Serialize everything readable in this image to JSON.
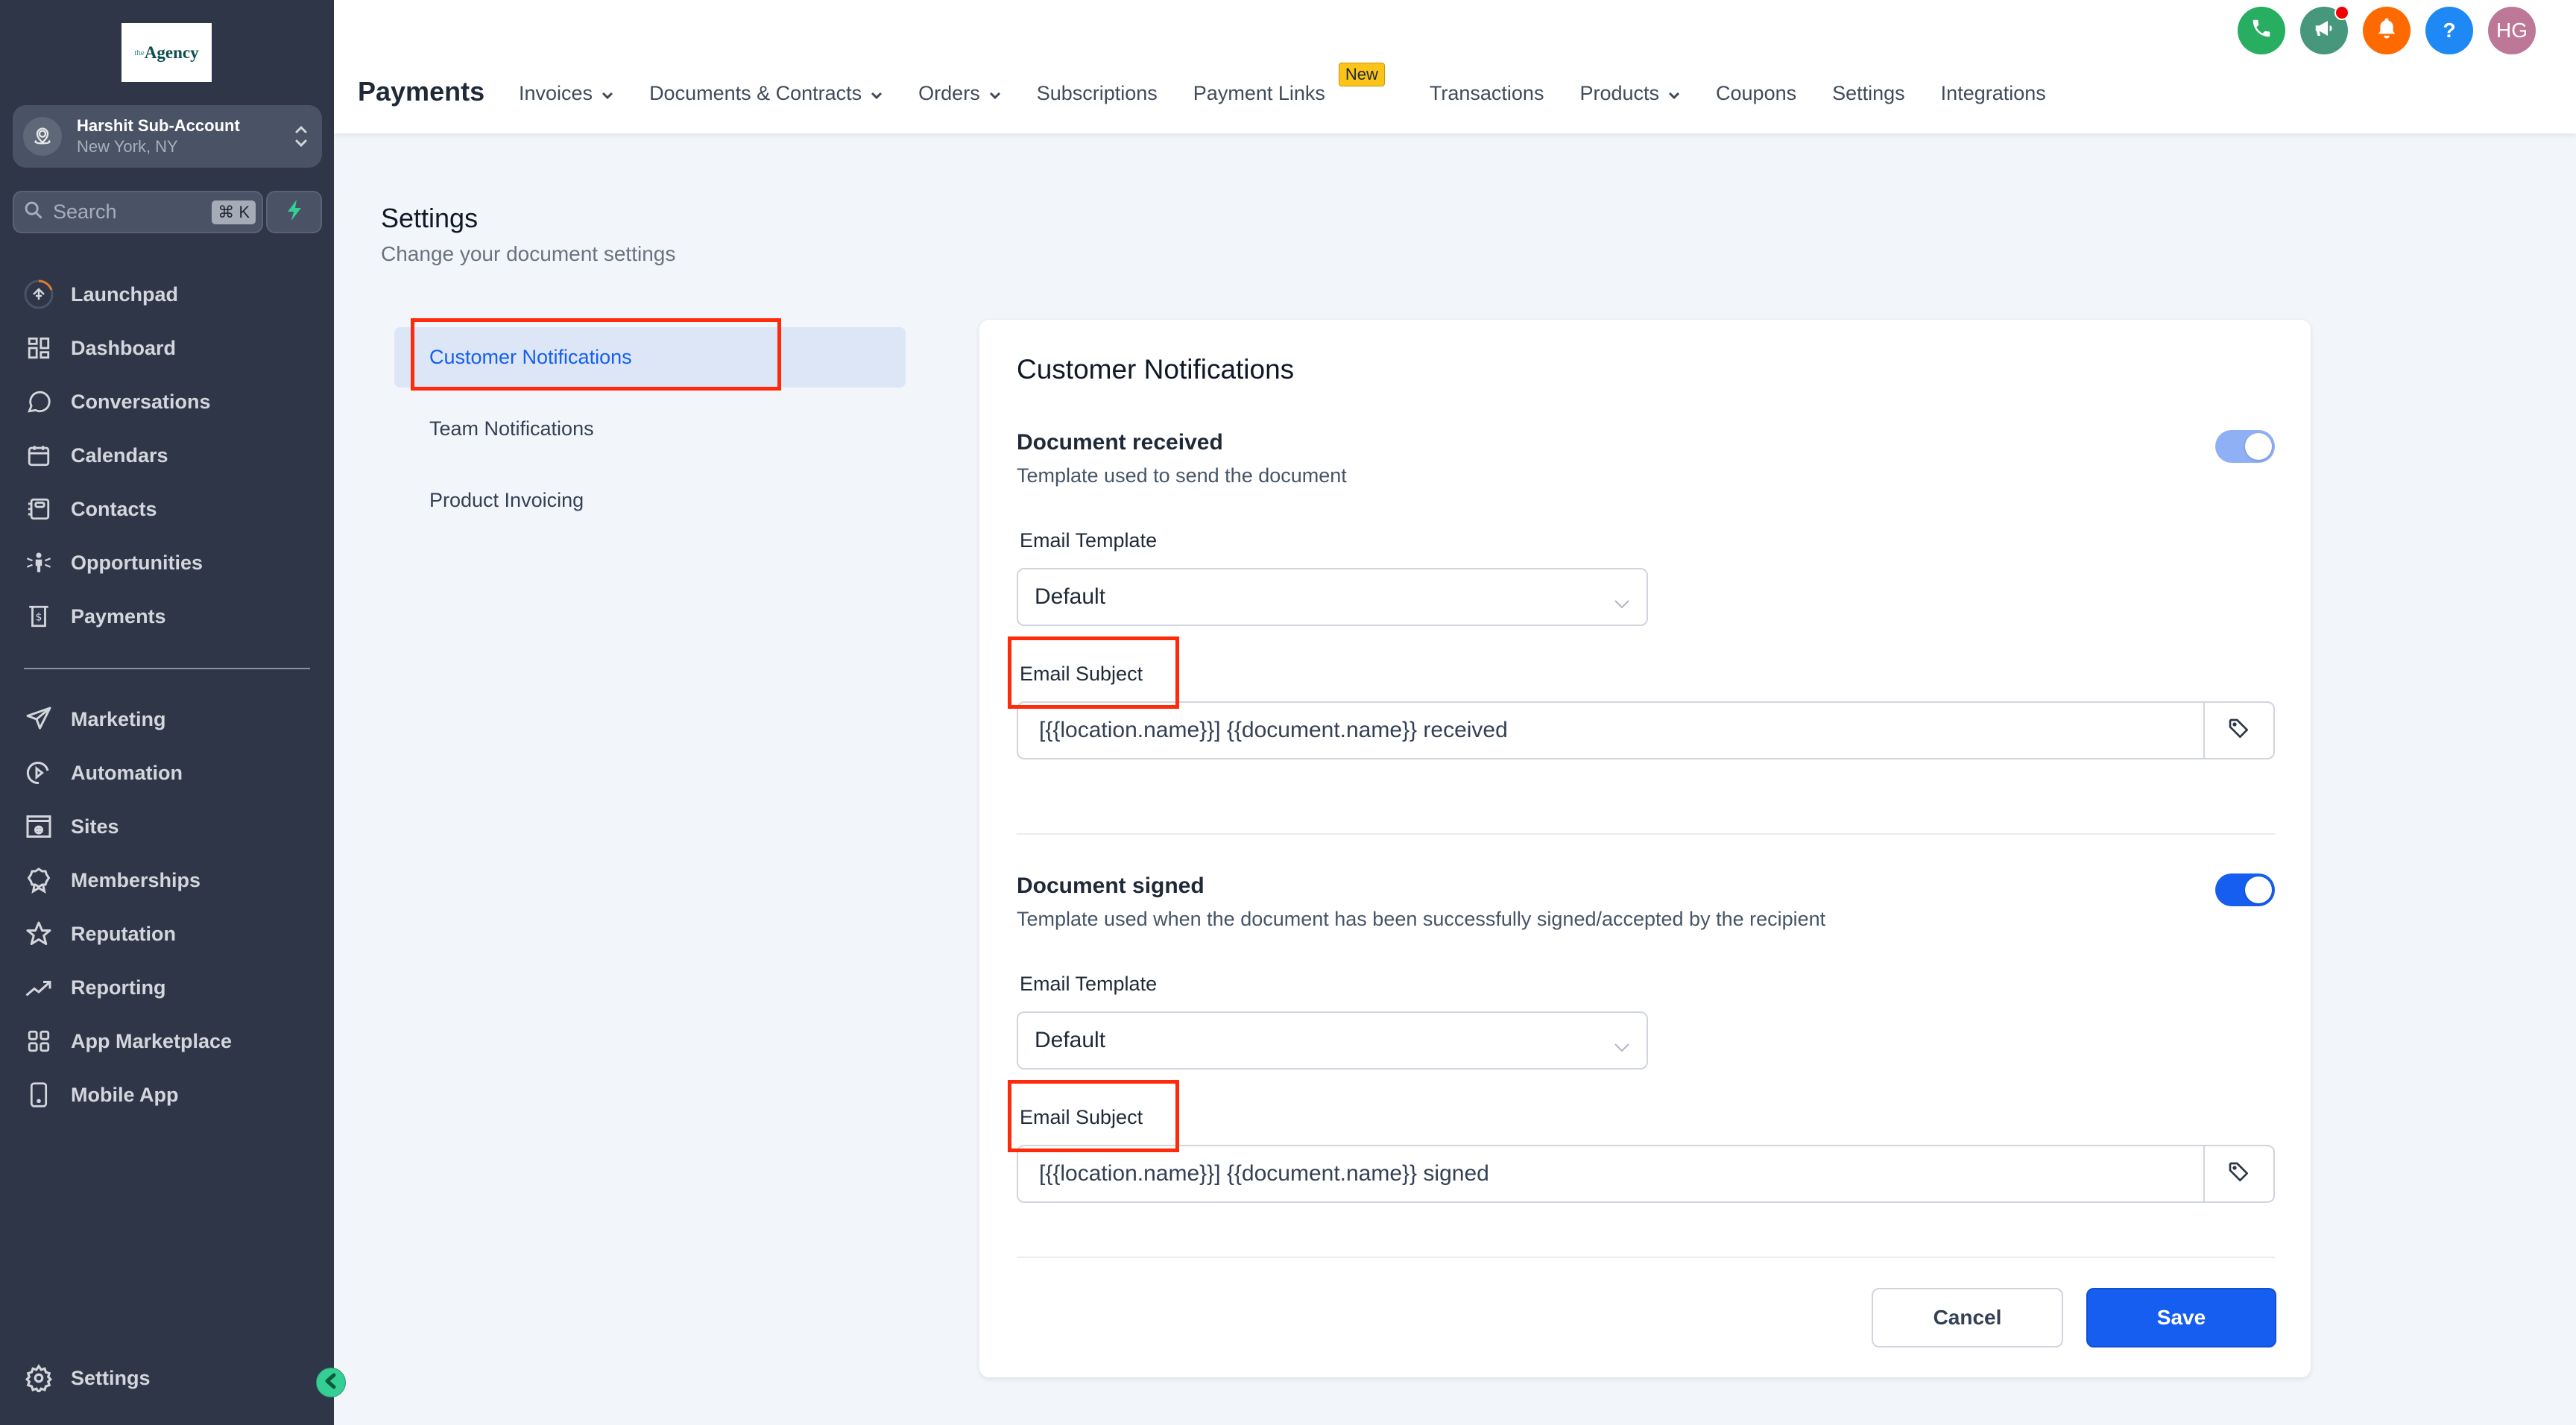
{
  "sidebar": {
    "logo": {
      "prefix": "the",
      "name": "Agency"
    },
    "account": {
      "name": "Harshit Sub-Account",
      "location": "New York, NY"
    },
    "search": {
      "placeholder": "Search",
      "shortcut": "⌘ K"
    },
    "nav_primary": [
      {
        "label": "Launchpad",
        "icon": "launchpad-icon"
      },
      {
        "label": "Dashboard",
        "icon": "dashboard-icon"
      },
      {
        "label": "Conversations",
        "icon": "chat-icon"
      },
      {
        "label": "Calendars",
        "icon": "calendar-icon"
      },
      {
        "label": "Contacts",
        "icon": "contacts-icon"
      },
      {
        "label": "Opportunities",
        "icon": "opportunities-icon"
      },
      {
        "label": "Payments",
        "icon": "payments-icon"
      }
    ],
    "nav_secondary": [
      {
        "label": "Marketing",
        "icon": "send-icon"
      },
      {
        "label": "Automation",
        "icon": "automation-icon"
      },
      {
        "label": "Sites",
        "icon": "sites-icon"
      },
      {
        "label": "Memberships",
        "icon": "badge-icon"
      },
      {
        "label": "Reputation",
        "icon": "star-icon"
      },
      {
        "label": "Reporting",
        "icon": "trend-icon"
      },
      {
        "label": "App Marketplace",
        "icon": "grid-icon"
      },
      {
        "label": "Mobile App",
        "icon": "mobile-icon"
      }
    ],
    "settings_label": "Settings"
  },
  "header": {
    "title": "Payments",
    "tabs": [
      {
        "label": "Invoices",
        "dropdown": true
      },
      {
        "label": "Documents & Contracts",
        "dropdown": true
      },
      {
        "label": "Orders",
        "dropdown": true
      },
      {
        "label": "Subscriptions",
        "dropdown": false
      },
      {
        "label": "Payment Links",
        "dropdown": false,
        "badge": "New"
      },
      {
        "label": "Transactions",
        "dropdown": false
      },
      {
        "label": "Products",
        "dropdown": true
      },
      {
        "label": "Coupons",
        "dropdown": false
      },
      {
        "label": "Settings",
        "dropdown": false
      },
      {
        "label": "Integrations",
        "dropdown": false
      }
    ],
    "icons": {
      "phone_color": "#27ae60",
      "announce_color": "#46977c",
      "bell_color": "#ff6a00",
      "help_color": "#1e88f5",
      "avatar_color": "#bd7898",
      "avatar_initials": "HG",
      "help_glyph": "?"
    }
  },
  "settings": {
    "title": "Settings",
    "subtitle": "Change your document settings",
    "menu": [
      {
        "label": "Customer Notifications",
        "active": true
      },
      {
        "label": "Team Notifications",
        "active": false
      },
      {
        "label": "Product Invoicing",
        "active": false
      }
    ]
  },
  "card": {
    "title": "Customer Notifications",
    "sections": [
      {
        "title": "Document received",
        "description": "Template used to send the document",
        "enabled": true,
        "toggle_color": "#8fb0f5",
        "template_label": "Email Template",
        "template_value": "Default",
        "subject_label": "Email Subject",
        "subject_value": "[{{location.name}}] {{document.name}} received"
      },
      {
        "title": "Document signed",
        "description": "Template used when the document has been successfully signed/accepted by the recipient",
        "enabled": true,
        "toggle_color": "#155eef",
        "template_label": "Email Template",
        "template_value": "Default",
        "subject_label": "Email Subject",
        "subject_value": "[{{location.name}}] {{document.name}} signed"
      }
    ],
    "cancel_label": "Cancel",
    "save_label": "Save"
  },
  "colors": {
    "accent": "#155eef",
    "sidebar_bg": "#2e3648",
    "highlight_box": "#ff2a0a",
    "new_badge": "#fcc419"
  }
}
